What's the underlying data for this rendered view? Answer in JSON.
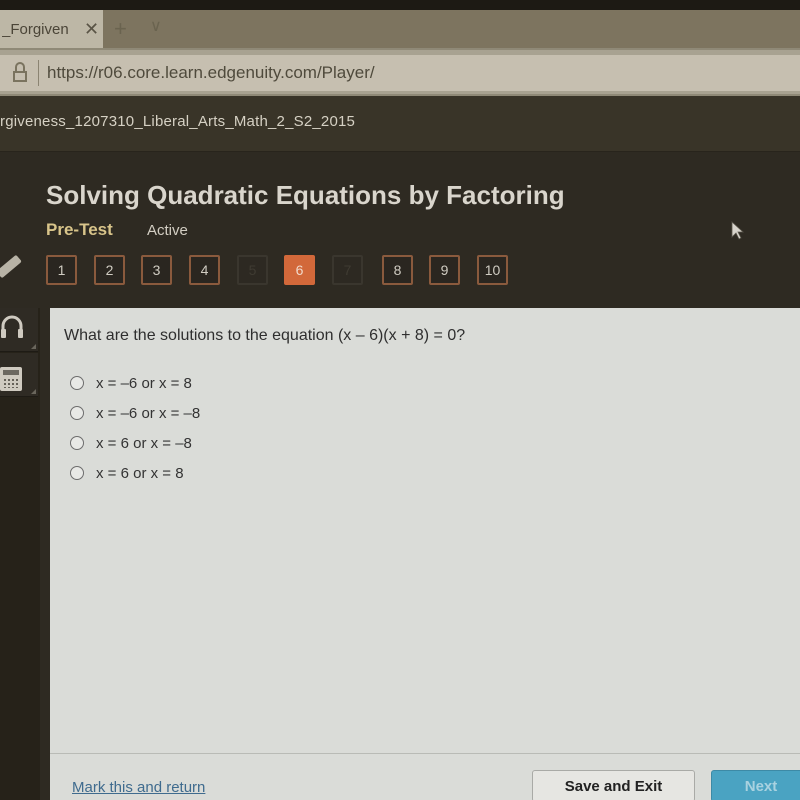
{
  "browser": {
    "tab_title": "_Forgiven",
    "tab_close_icon": "close-icon",
    "new_tab_icon": "plus-icon",
    "tab_list_icon": "chevron-down-icon",
    "new_tab_glyph": "+",
    "tab_list_glyph": "∨",
    "close_glyph": "✕",
    "url": "https://r06.core.learn.edgenuity.com/Player/"
  },
  "course": {
    "title": "rgiveness_1207310_Liberal_Arts_Math_2_S2_2015"
  },
  "lesson": {
    "title": "Solving Quadratic Equations by Factoring",
    "activity_type": "Pre-Test",
    "status": "Active"
  },
  "question_nav": {
    "current": 6,
    "items": [
      {
        "label": "1",
        "state": "normal"
      },
      {
        "label": "2",
        "state": "normal"
      },
      {
        "label": "3",
        "state": "normal"
      },
      {
        "label": "4",
        "state": "normal"
      },
      {
        "label": "5",
        "state": "disabled"
      },
      {
        "label": "6",
        "state": "current"
      },
      {
        "label": "7",
        "state": "disabled"
      },
      {
        "label": "8",
        "state": "normal"
      },
      {
        "label": "9",
        "state": "normal"
      },
      {
        "label": "10",
        "state": "normal"
      }
    ]
  },
  "tools": [
    {
      "name": "pencil-icon"
    },
    {
      "name": "headphones-icon"
    },
    {
      "name": "calculator-icon"
    }
  ],
  "question": {
    "prompt": "What are the solutions to the equation (x – 6)(x + 8) = 0?",
    "choices": [
      {
        "label": "x = –6 or x = 8",
        "selected": false
      },
      {
        "label": "x = –6 or x = –8",
        "selected": false
      },
      {
        "label": "x = 6 or x = –8",
        "selected": false
      },
      {
        "label": "x = 6 or x = 8",
        "selected": false
      }
    ]
  },
  "footer": {
    "mark_link": "Mark this and return",
    "save_exit": "Save and Exit",
    "next": "Next"
  },
  "colors": {
    "accent_current": "#d2683a",
    "pretest_label": "#d8c48a",
    "next_button": "#4aa3c2",
    "link": "#3f6b8e"
  }
}
